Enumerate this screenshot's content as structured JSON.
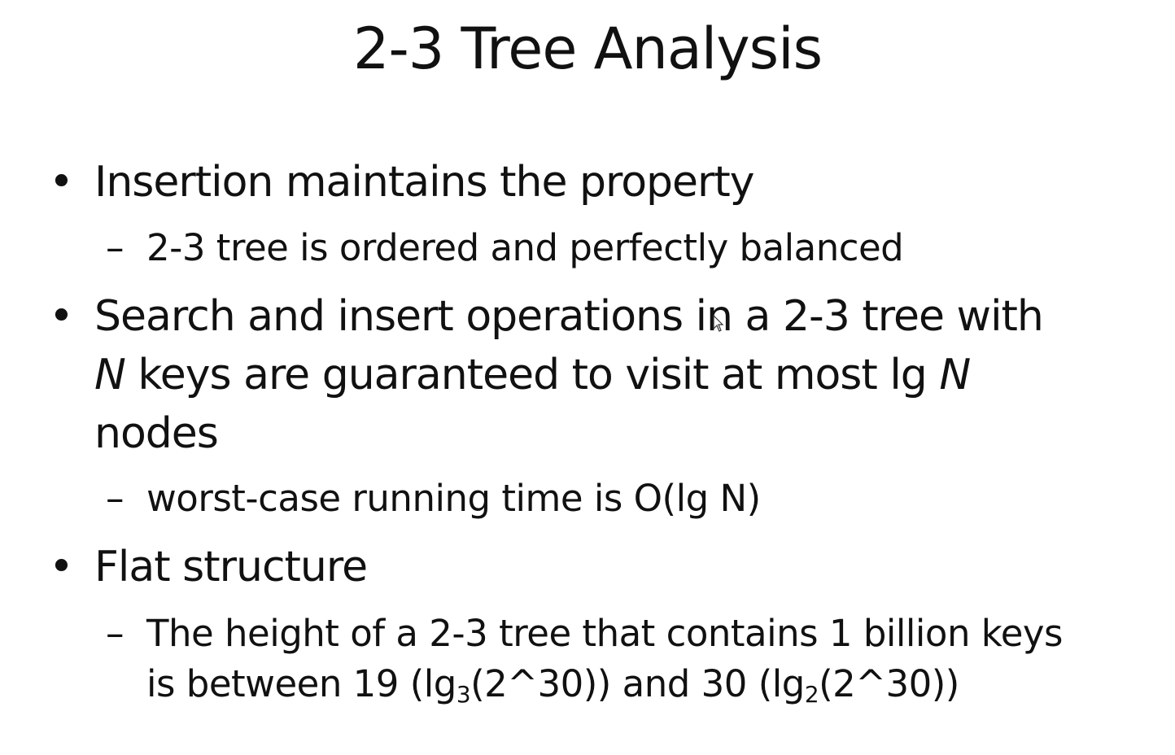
{
  "slide": {
    "title": "2-3 Tree Analysis",
    "bullet_glyph": "•",
    "dash_glyph": "–",
    "b1": {
      "text": "Insertion maintains the property",
      "sub": "2-3 tree is ordered and perfectly balanced"
    },
    "b2": {
      "part1": "Search and insert operations in a 2-3 tree with",
      "n1": "N",
      "part2": " keys are guaranteed to visit at most lg ",
      "n2": "N",
      "part3": "nodes",
      "sub": "worst-case running time is O(lg N)"
    },
    "b3": {
      "text": "Flat structure",
      "sub_line1": "The height of a 2-3 tree that contains 1 billion keys",
      "sub_line2_a": "is between 19 (lg",
      "sub_line2_sub3": "3",
      "sub_line2_b": "(2^30)) and 30 (lg",
      "sub_line2_sub2": "2",
      "sub_line2_c": "(2^30))"
    }
  }
}
